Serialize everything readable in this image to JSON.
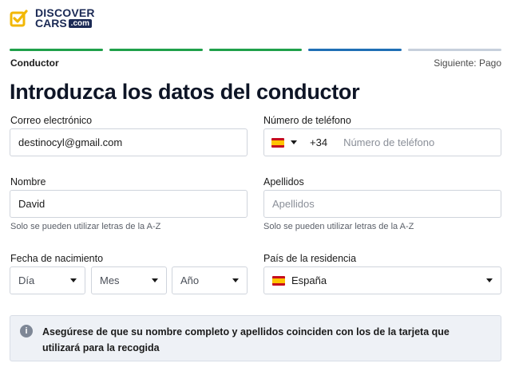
{
  "brand": {
    "line1": "DISCOVER",
    "line2": "CARS",
    "tld": ".com",
    "logo_icon": "checkmark-square-icon",
    "colors": {
      "brand_navy": "#1b2a55",
      "brand_yellow": "#f2b705"
    }
  },
  "progress": {
    "steps": [
      {
        "state": "done",
        "color": "#1fa04a"
      },
      {
        "state": "done",
        "color": "#1fa04a"
      },
      {
        "state": "done",
        "color": "#1fa04a"
      },
      {
        "state": "current",
        "color": "#1f6fb5"
      },
      {
        "state": "pending",
        "color": "#c7d0dc"
      }
    ]
  },
  "step": {
    "current": "Conductor",
    "next": "Siguiente: Pago"
  },
  "page_title": "Introduzca los datos del conductor",
  "form": {
    "email": {
      "label": "Correo electrónico",
      "value": "destinocyl@gmail.com"
    },
    "phone": {
      "label": "Número de teléfono",
      "country_flag": "flag-es-icon",
      "dial_code": "+34",
      "placeholder": "Número de teléfono"
    },
    "first_name": {
      "label": "Nombre",
      "value": "David",
      "hint": "Solo se pueden utilizar letras de la A-Z"
    },
    "last_name": {
      "label": "Apellidos",
      "placeholder": "Apellidos",
      "hint": "Solo se pueden utilizar letras de la A-Z"
    },
    "dob": {
      "label": "Fecha de nacimiento",
      "day": "Día",
      "month": "Mes",
      "year": "Año"
    },
    "country": {
      "label": "País de la residencia",
      "value": "España",
      "flag": "flag-es-icon"
    }
  },
  "notice": {
    "icon": "info-icon",
    "text": "Asegúrese de que su nombre completo y apellidos coinciden con los de la tarjeta que utilizará para la recogida"
  }
}
